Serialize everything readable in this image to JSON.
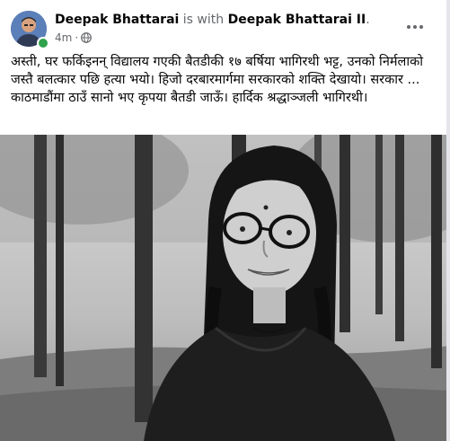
{
  "post": {
    "author": "Deepak Bhattarai",
    "with_text": " is with ",
    "tagged": "Deepak Bhattarai II",
    "tagged_suffix": ".",
    "time": "4m",
    "time_separator": "·",
    "privacy_icon": "globe-icon",
    "more_icon": "more-horizontal-icon",
    "body": "अस्ती, घर फर्किइनन् विद्यालय गएकी  बैतडीकी १७ बर्षिया भागिरथी भट्ट, उनको निर्मलाको जस्तै बलत्कार पछि हत्या भयो।  हिजो दरबारमार्गमा सरकारको शक्ति देखायो।  सरकार ...  काठमाडौंमा ठाउँ सानो भए कृपया बैतडी जाऊँ। हार्दिक श्रद्धाञ्जली भागिरथी।",
    "photo_description": "black-and-white portrait photo"
  },
  "colors": {
    "text_primary": "#050505",
    "text_secondary": "#65676b",
    "online": "#31a24c"
  }
}
